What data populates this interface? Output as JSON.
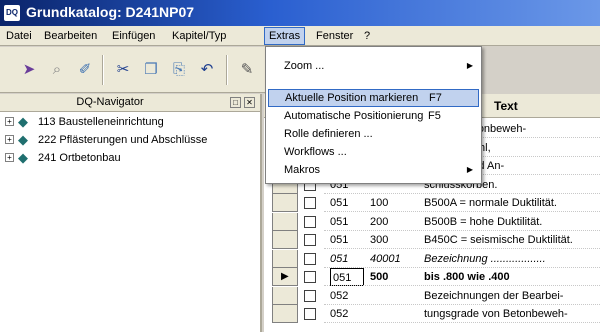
{
  "window": {
    "app_icon_text": "DQ",
    "title": "Grundkatalog: D241NP07"
  },
  "menubar": [
    {
      "label": "Datei"
    },
    {
      "label": "Bearbeiten"
    },
    {
      "label": "Einfügen"
    },
    {
      "label": "Kapitel/Typ"
    },
    {
      "label": "Extras"
    },
    {
      "label": "Fenster"
    },
    {
      "label": "?"
    }
  ],
  "toolbar": {
    "icons": [
      "exit-icon",
      "search-icon",
      "find-replace-icon",
      "cut-icon",
      "copy-icon",
      "paste-icon",
      "undo-icon",
      "edit-icon"
    ]
  },
  "navigator": {
    "title": "DQ-Navigator",
    "items": [
      {
        "expander": "+",
        "label": "113 Baustelleneinrichtung"
      },
      {
        "expander": "+",
        "label": "222 Pflästerungen und Abschlüsse"
      },
      {
        "expander": "+",
        "label": "241 Ortbetonbau"
      }
    ]
  },
  "grid": {
    "column_text": "Text",
    "rows": [
      {
        "a": "",
        "b": "",
        "c": "gen für Betonbeweh-",
        "style": ""
      },
      {
        "a": "",
        "b": "",
        "c": "ei Betonstahl,",
        "style": ""
      },
      {
        "a": "",
        "b": "",
        "c": "smatten und An-",
        "style": ""
      },
      {
        "a": "051",
        "b": "",
        "c": "schlusskörben.",
        "style": ""
      },
      {
        "a": "051",
        "b": "100",
        "c": "B500A = normale Duktilität.",
        "style": ""
      },
      {
        "a": "051",
        "b": "200",
        "c": "B500B = hohe Duktilität.",
        "style": ""
      },
      {
        "a": "051",
        "b": "300",
        "c": "B450C = seismische Duktilität.",
        "style": ""
      },
      {
        "a": "051",
        "b": "40001",
        "c": "Bezeichnung ..................",
        "style": "italic"
      },
      {
        "a": "051",
        "b": "500",
        "c": "bis .800 wie .400",
        "style": "bold"
      },
      {
        "a": "052",
        "b": "",
        "c": "Bezeichnungen der Bearbei-",
        "style": ""
      },
      {
        "a": "052",
        "b": "",
        "c": "tungsgrade von Betonbeweh-",
        "style": ""
      }
    ]
  },
  "extras_menu": {
    "items": [
      {
        "label": "Zoom ...",
        "shortcut": "",
        "submenu": true
      },
      {
        "label": "Aktuelle Position markieren",
        "shortcut": "F7",
        "submenu": false
      },
      {
        "label": "Automatische Positionierung",
        "shortcut": "F5",
        "submenu": false
      },
      {
        "label": "Rolle definieren ...",
        "shortcut": "",
        "submenu": false
      },
      {
        "label": "Workflows ...",
        "shortcut": "",
        "submenu": false
      },
      {
        "label": "Makros",
        "shortcut": "",
        "submenu": true
      }
    ]
  },
  "colors": {
    "title_gradient_start": "#0a246a",
    "menu_highlight": "#c1d2ee",
    "menu_highlight_border": "#316ac5",
    "tree_icon": "#1f6f6f"
  }
}
